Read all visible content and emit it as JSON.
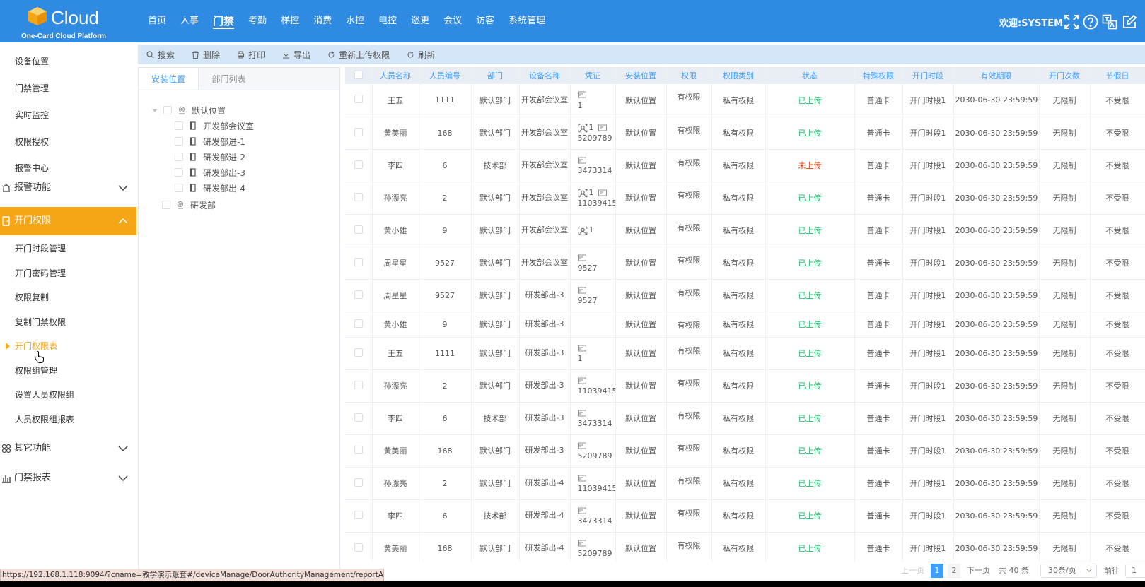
{
  "header": {
    "logo_title": "Cloud",
    "logo_subtitle": "One-Card Cloud Platform",
    "nav": [
      "首页",
      "人事",
      "门禁",
      "考勤",
      "梯控",
      "消费",
      "水控",
      "电控",
      "巡更",
      "会议",
      "访客",
      "系统管理"
    ],
    "nav_active_index": 2,
    "welcome": "欢迎:SYSTEM",
    "icons": [
      "fullscreen-icon",
      "help-icon",
      "language-icon",
      "edit-icon"
    ],
    "brand_color": "#2f8ae2"
  },
  "sidebar": {
    "top_items": [
      "设备位置",
      "门禁管理",
      "实时监控",
      "权限授权",
      "报警中心"
    ],
    "groups": {
      "alarm": {
        "label": "报警功能",
        "icon": "alarm-icon"
      },
      "door_permission": {
        "label": "开门权限",
        "icon": "door-icon",
        "expanded": true
      },
      "other": {
        "label": "其它功能",
        "icon": "apps-icon"
      },
      "report": {
        "label": "门禁报表",
        "icon": "chart-icon"
      }
    },
    "sub_items": [
      "开门时段管理",
      "开门密码管理",
      "权限复制",
      "复制门禁权限",
      "开门权限表",
      "权限组管理",
      "设置人员权限组",
      "人员权限组报表"
    ],
    "current_sub_index": 4,
    "accent_color": "#f5a616"
  },
  "toolbar": {
    "buttons": [
      {
        "label": "搜索",
        "icon": "search-icon"
      },
      {
        "label": "删除",
        "icon": "trash-icon"
      },
      {
        "label": "打印",
        "icon": "print-icon"
      },
      {
        "label": "导出",
        "icon": "download-icon"
      },
      {
        "label": "重新上传权限",
        "icon": "refresh-icon"
      },
      {
        "label": "刷新",
        "icon": "refresh-icon"
      }
    ]
  },
  "tree": {
    "tabs": [
      "安装位置",
      "部门列表"
    ],
    "root": "默认位置",
    "children": [
      "开发部会议室",
      "研发部进-1",
      "研发部进-2",
      "研发部出-3",
      "研发部出-4"
    ],
    "sibling": "研发部"
  },
  "table": {
    "headers": [
      "人员名称",
      "人员编号",
      "部门",
      "设备名称",
      "凭证",
      "安装位置",
      "权限",
      "权限类别",
      "状态",
      "特殊权限",
      "开门时段",
      "有效期限",
      "开门次数",
      "节假日"
    ],
    "rows": [
      {
        "name": "王五",
        "no": "1111",
        "dept": "默认部门",
        "device": "开发部会议室",
        "face": "",
        "card": "1",
        "loc": "默认位置",
        "perm": "有权限",
        "ptype": "私有权限",
        "status": "已上传",
        "special": "普通卡",
        "period": "开门时段1",
        "expire": "2030-06-30 23:59:59",
        "times": "无限制",
        "holiday": "不受限"
      },
      {
        "name": "黄美丽",
        "no": "168",
        "dept": "默认部门",
        "device": "开发部会议室",
        "face": "1",
        "card": "5209789",
        "loc": "默认位置",
        "perm": "有权限",
        "ptype": "私有权限",
        "status": "已上传",
        "special": "普通卡",
        "period": "开门时段1",
        "expire": "2030-06-30 23:59:59",
        "times": "无限制",
        "holiday": "不受限"
      },
      {
        "name": "李四",
        "no": "6",
        "dept": "技术部",
        "device": "开发部会议室",
        "face": "",
        "card": "3473314",
        "loc": "默认位置",
        "perm": "有权限",
        "ptype": "私有权限",
        "status": "未上传",
        "special": "普通卡",
        "period": "开门时段1",
        "expire": "2030-06-30 23:59:59",
        "times": "无限制",
        "holiday": "不受限"
      },
      {
        "name": "孙漂亮",
        "no": "2",
        "dept": "默认部门",
        "device": "开发部会议室",
        "face": "1",
        "card": "11039415",
        "loc": "默认位置",
        "perm": "有权限",
        "ptype": "私有权限",
        "status": "已上传",
        "special": "普通卡",
        "period": "开门时段1",
        "expire": "2030-06-30 23:59:59",
        "times": "无限制",
        "holiday": "不受限"
      },
      {
        "name": "黄小雄",
        "no": "9",
        "dept": "默认部门",
        "device": "开发部会议室",
        "face": "1",
        "card": "",
        "loc": "默认位置",
        "perm": "有权限",
        "ptype": "私有权限",
        "status": "已上传",
        "special": "普通卡",
        "period": "开门时段1",
        "expire": "2030-06-30 23:59:59",
        "times": "无限制",
        "holiday": "不受限"
      },
      {
        "name": "周星星",
        "no": "9527",
        "dept": "默认部门",
        "device": "开发部会议室",
        "face": "",
        "card": "9527",
        "loc": "默认位置",
        "perm": "有权限",
        "ptype": "私有权限",
        "status": "已上传",
        "special": "普通卡",
        "period": "开门时段1",
        "expire": "2030-06-30 23:59:59",
        "times": "无限制",
        "holiday": "不受限"
      },
      {
        "name": "周星星",
        "no": "9527",
        "dept": "默认部门",
        "device": "研发部出-3",
        "face": "",
        "card": "9527",
        "loc": "默认位置",
        "perm": "有权限",
        "ptype": "私有权限",
        "status": "已上传",
        "special": "普通卡",
        "period": "开门时段1",
        "expire": "2030-06-30 23:59:59",
        "times": "无限制",
        "holiday": "不受限"
      },
      {
        "name": "黄小雄",
        "no": "9",
        "dept": "默认部门",
        "device": "研发部出-3",
        "face": "",
        "card": "",
        "loc": "默认位置",
        "perm": "有权限",
        "ptype": "私有权限",
        "status": "已上传",
        "special": "普通卡",
        "period": "开门时段1",
        "expire": "2030-06-30 23:59:59",
        "times": "无限制",
        "holiday": "不受限"
      },
      {
        "name": "王五",
        "no": "1111",
        "dept": "默认部门",
        "device": "研发部出-3",
        "face": "",
        "card": "1",
        "loc": "默认位置",
        "perm": "有权限",
        "ptype": "私有权限",
        "status": "已上传",
        "special": "普通卡",
        "period": "开门时段1",
        "expire": "2030-06-30 23:59:59",
        "times": "无限制",
        "holiday": "不受限"
      },
      {
        "name": "孙漂亮",
        "no": "2",
        "dept": "默认部门",
        "device": "研发部出-3",
        "face": "",
        "card": "11039415",
        "loc": "默认位置",
        "perm": "有权限",
        "ptype": "私有权限",
        "status": "已上传",
        "special": "普通卡",
        "period": "开门时段1",
        "expire": "2030-06-30 23:59:59",
        "times": "无限制",
        "holiday": "不受限"
      },
      {
        "name": "李四",
        "no": "6",
        "dept": "技术部",
        "device": "研发部出-3",
        "face": "",
        "card": "3473314",
        "loc": "默认位置",
        "perm": "有权限",
        "ptype": "私有权限",
        "status": "已上传",
        "special": "普通卡",
        "period": "开门时段1",
        "expire": "2030-06-30 23:59:59",
        "times": "无限制",
        "holiday": "不受限"
      },
      {
        "name": "黄美丽",
        "no": "168",
        "dept": "默认部门",
        "device": "研发部出-3",
        "face": "",
        "card": "5209789",
        "loc": "默认位置",
        "perm": "有权限",
        "ptype": "私有权限",
        "status": "已上传",
        "special": "普通卡",
        "period": "开门时段1",
        "expire": "2030-06-30 23:59:59",
        "times": "无限制",
        "holiday": "不受限"
      },
      {
        "name": "孙漂亮",
        "no": "2",
        "dept": "默认部门",
        "device": "研发部出-4",
        "face": "",
        "card": "11039415",
        "loc": "默认位置",
        "perm": "有权限",
        "ptype": "私有权限",
        "status": "已上传",
        "special": "普通卡",
        "period": "开门时段1",
        "expire": "2030-06-30 23:59:59",
        "times": "无限制",
        "holiday": "不受限"
      },
      {
        "name": "李四",
        "no": "6",
        "dept": "技术部",
        "device": "研发部出-4",
        "face": "",
        "card": "3473314",
        "loc": "默认位置",
        "perm": "有权限",
        "ptype": "私有权限",
        "status": "已上传",
        "special": "普通卡",
        "period": "开门时段1",
        "expire": "2030-06-30 23:59:59",
        "times": "无限制",
        "holiday": "不受限"
      },
      {
        "name": "黄美丽",
        "no": "168",
        "dept": "默认部门",
        "device": "研发部出-4",
        "face": "",
        "card": "5209789",
        "loc": "默认位置",
        "perm": "有权限",
        "ptype": "私有权限",
        "status": "已上传",
        "special": "普通卡",
        "period": "开门时段1",
        "expire": "2030-06-30 23:59:59",
        "times": "无限制",
        "holiday": "不受限"
      }
    ],
    "status_colors": {
      "ok": "#19be6b",
      "fail": "#ed4014"
    }
  },
  "pager": {
    "prev": "上一页",
    "pages": [
      "1",
      "2"
    ],
    "current": "1",
    "next": "下一页",
    "total": "共 40 条",
    "page_size": "30条/页",
    "goto_label": "前往",
    "goto_value": "1"
  },
  "status_url": "https://192.168.1.118:9094/?cname=教学演示账套#/deviceManage/DoorAuthorityManagement/reportAccre..."
}
